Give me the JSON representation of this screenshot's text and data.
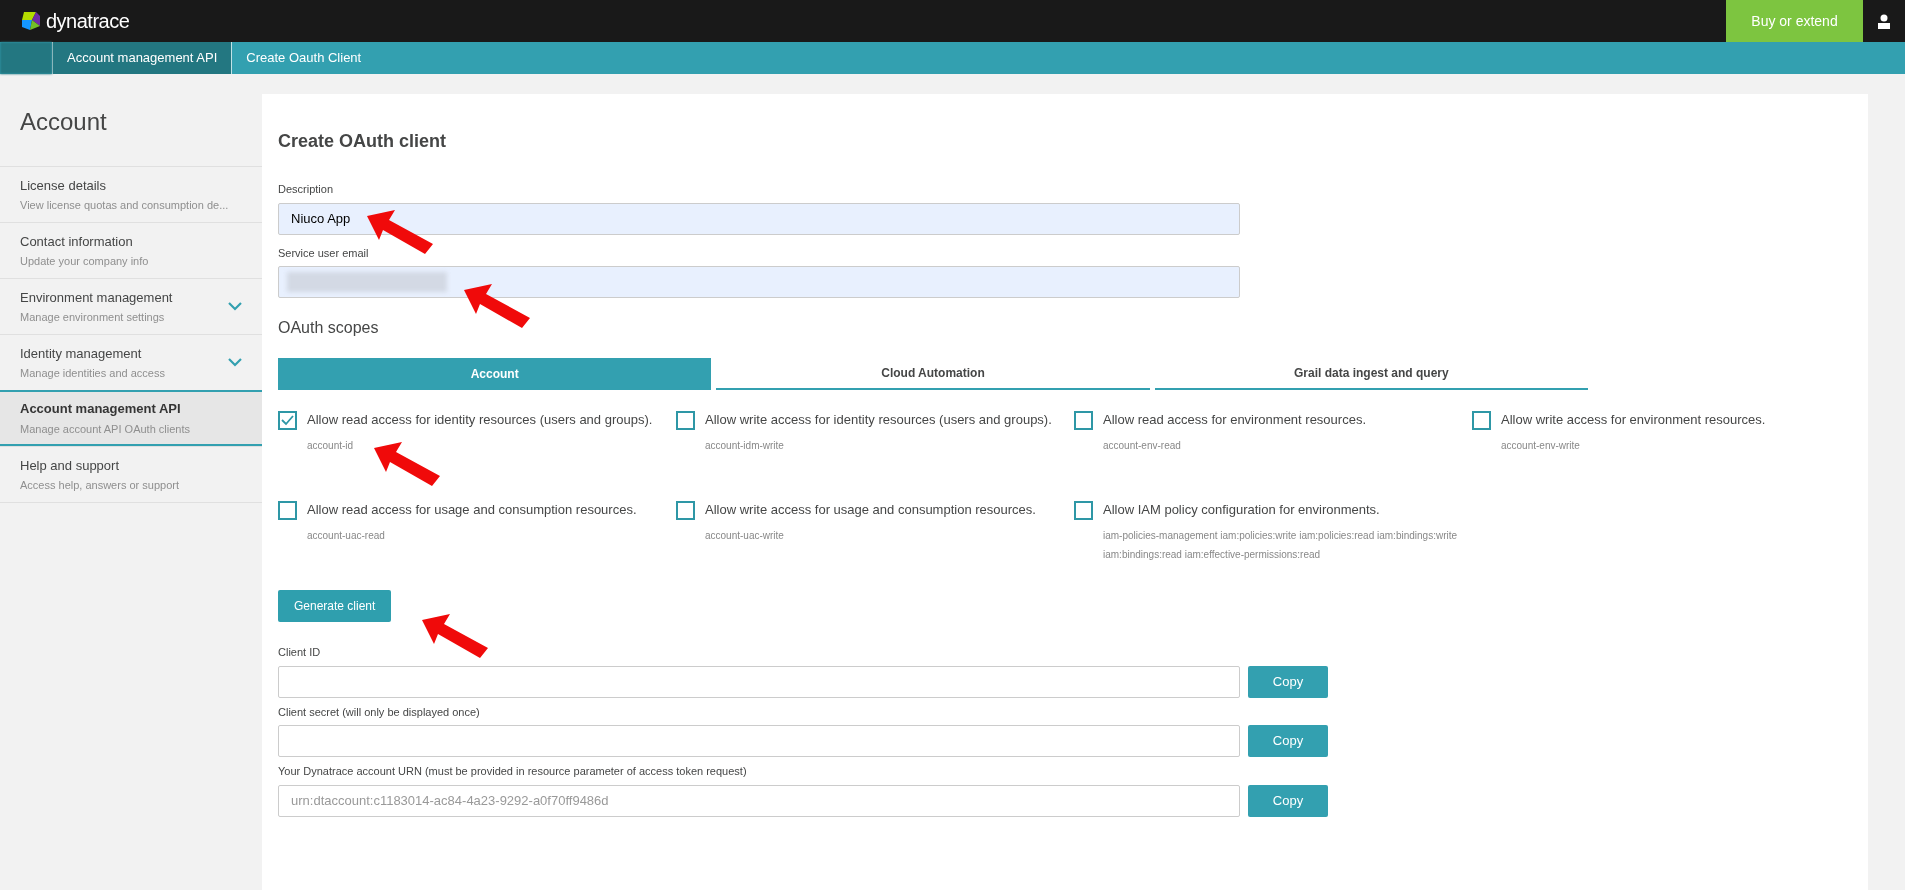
{
  "header": {
    "logo_text": "dynatrace",
    "buy_button": "Buy or extend"
  },
  "breadcrumbs": [
    {
      "label": "Account management API",
      "selected": false
    },
    {
      "label": "Create Oauth Client",
      "selected": true
    }
  ],
  "sidebar": {
    "title": "Account",
    "items": [
      {
        "label": "License details",
        "description": "View license quotas and consumption de...",
        "selected": false,
        "expandable": false
      },
      {
        "label": "Contact information",
        "description": "Update your company info",
        "selected": false,
        "expandable": false
      },
      {
        "label": "Environment management",
        "description": "Manage environment settings",
        "selected": false,
        "expandable": true
      },
      {
        "label": "Identity management",
        "description": "Manage identities and access",
        "selected": false,
        "expandable": true
      },
      {
        "label": "Account management API",
        "description": "Manage account API OAuth clients",
        "selected": true,
        "expandable": false
      },
      {
        "label": "Help and support",
        "description": "Access help, answers or support",
        "selected": false,
        "expandable": false
      }
    ]
  },
  "form": {
    "title": "Create OAuth client",
    "description": {
      "label": "Description",
      "value": "Niuco App"
    },
    "service_user_email": {
      "label": "Service user email"
    },
    "scopes_heading": "OAuth scopes",
    "tabs": [
      {
        "label": "Account",
        "selected": true
      },
      {
        "label": "Cloud Automation",
        "selected": false
      },
      {
        "label": "Grail data ingest and query",
        "selected": false
      }
    ],
    "scopes": [
      {
        "label": "Allow read access for identity resources (users and groups).",
        "scope": "account-id",
        "checked": true
      },
      {
        "label": "Allow write access for identity resources (users and groups).",
        "scope": "account-idm-write",
        "checked": false
      },
      {
        "label": "Allow read access for environment resources.",
        "scope": "account-env-read",
        "checked": false
      },
      {
        "label": "Allow write access for environment resources.",
        "scope": "account-env-write",
        "checked": false
      },
      {
        "label": "Allow read access for usage and consumption resources.",
        "scope": "account-uac-read",
        "checked": false
      },
      {
        "label": "Allow write access for usage and consumption resources.",
        "scope": "account-uac-write",
        "checked": false
      },
      {
        "label": "Allow IAM policy configuration for environments.",
        "scope": "iam-policies-management iam:policies:write iam:policies:read iam:bindings:write iam:bindings:read iam:effective-permissions:read",
        "checked": false
      }
    ],
    "generate_button": "Generate client",
    "outputs": [
      {
        "label": "Client ID",
        "button": "Copy"
      },
      {
        "label": "Client secret (will only be displayed once)",
        "button": "Copy"
      },
      {
        "label": "Your Dynatrace account URN (must be provided in resource parameter of access token request)",
        "value": "urn:dtaccount:c1183014-ac84-4a23-9292-a0f70ff9486d",
        "button": "Copy"
      }
    ]
  }
}
